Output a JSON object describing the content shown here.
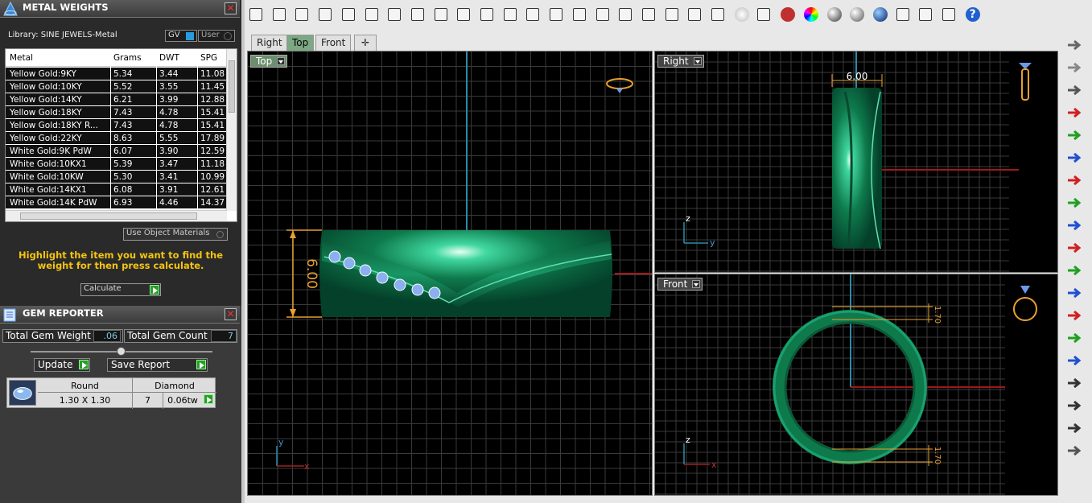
{
  "metal_panel": {
    "title": "METAL WEIGHTS",
    "library": "Library: SINE JEWELS-Metal",
    "gv_label": "GV",
    "user_label": "User",
    "columns": [
      "Metal",
      "Grams",
      "DWT",
      "SPG"
    ],
    "rows": [
      [
        "Yellow Gold:9KY",
        "5.34",
        "3.44",
        "11.08"
      ],
      [
        "Yellow Gold:10KY",
        "5.52",
        "3.55",
        "11.45"
      ],
      [
        "Yellow Gold:14KY",
        "6.21",
        "3.99",
        "12.88"
      ],
      [
        "Yellow Gold:18KY",
        "7.43",
        "4.78",
        "15.41"
      ],
      [
        "Yellow Gold:18KY R...",
        "7.43",
        "4.78",
        "15.41"
      ],
      [
        "Yellow Gold:22KY",
        "8.63",
        "5.55",
        "17.89"
      ],
      [
        "White Gold:9K PdW",
        "6.07",
        "3.90",
        "12.59"
      ],
      [
        "White Gold:10KX1",
        "5.39",
        "3.47",
        "11.18"
      ],
      [
        "White Gold:10KW",
        "5.30",
        "3.41",
        "10.99"
      ],
      [
        "White Gold:14KX1",
        "6.08",
        "3.91",
        "12.61"
      ],
      [
        "White Gold:14K PdW",
        "6.93",
        "4.46",
        "14.37"
      ]
    ],
    "use_object_materials": "Use Object Materials",
    "hint": "Highlight the item you want to find the weight for then press calculate.",
    "calculate": "Calculate"
  },
  "gem_panel": {
    "title": "GEM REPORTER",
    "total_weight_label": "Total Gem Weight",
    "total_weight": ".06",
    "total_count_label": "Total Gem Count",
    "total_count": "7",
    "update": "Update",
    "save_report": "Save Report",
    "gem": {
      "shape": "Round",
      "type": "Diamond",
      "size": "1.30 X 1.30",
      "count": "7",
      "weight": "0.06tw"
    }
  },
  "tabs": [
    "Right",
    "Top",
    "Front"
  ],
  "viewports": {
    "top": {
      "label": "Top",
      "dim": "6.00",
      "axis_y": "y",
      "axis_x": "x"
    },
    "right": {
      "label": "Right",
      "dim": "6.00",
      "axis_z": "z",
      "axis_y": "y"
    },
    "front": {
      "label": "Front",
      "dim1": "1.70",
      "dim2": "1.70",
      "axis_z": "z",
      "axis_x": "x"
    }
  }
}
